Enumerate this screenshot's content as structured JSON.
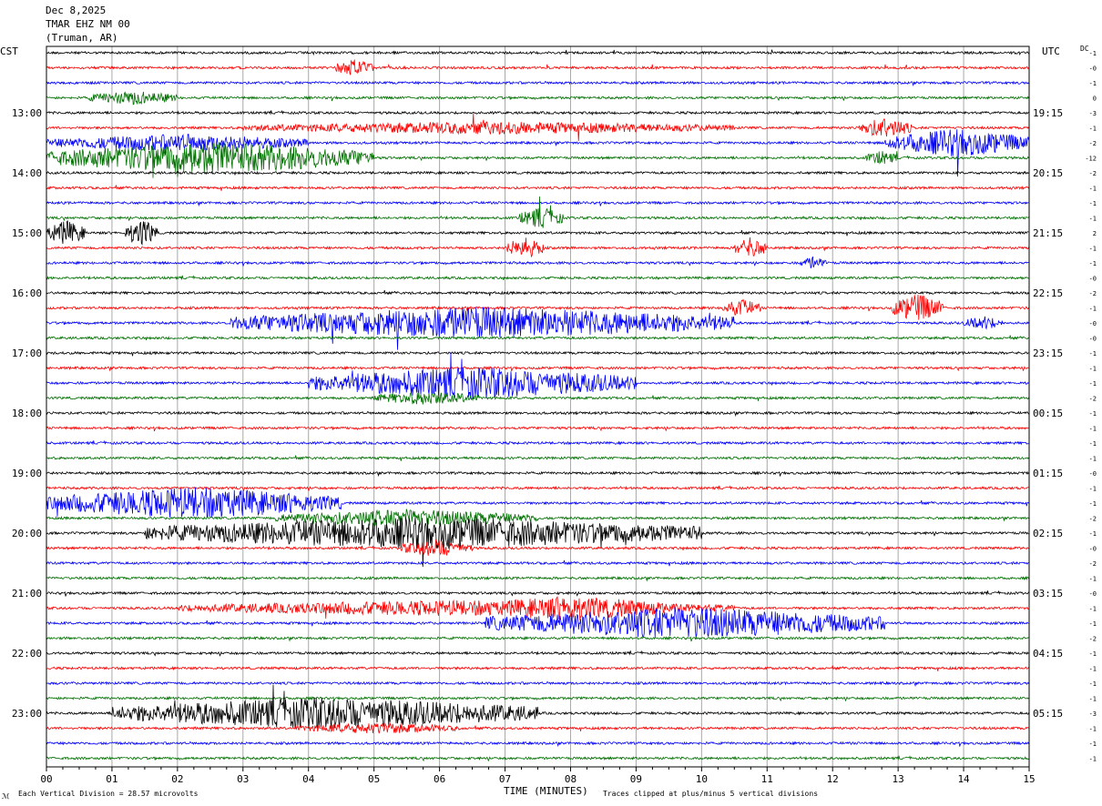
{
  "header": {
    "date": "Dec 8,2025",
    "station": "TMAR EHZ NM 00",
    "location": "(Truman, AR)"
  },
  "left_axis_label": "CST",
  "right_axis_label": "UTC",
  "dc_label": "DC",
  "footer": {
    "scale_text": "Each Vertical Division =   28.57 microvolts",
    "x_axis_title": "TIME (MINUTES)",
    "clip_text": "Traces clipped at plus/minus 5 vertical divisions",
    "corner_mark": "ℳ"
  },
  "chart_data": {
    "type": "line",
    "title": "",
    "xlabel": "TIME (MINUTES)",
    "ylabel": "",
    "xlim": [
      0,
      15
    ],
    "x_ticks": [
      "00",
      "01",
      "02",
      "03",
      "04",
      "05",
      "06",
      "07",
      "08",
      "09",
      "10",
      "11",
      "12",
      "13",
      "14",
      "15"
    ],
    "line_count": 48,
    "line_colors": [
      "#000000",
      "#ff0000",
      "#0000ff",
      "#007000"
    ],
    "cst_labels": [
      {
        "line": 4,
        "label": "13:00"
      },
      {
        "line": 8,
        "label": "14:00"
      },
      {
        "line": 12,
        "label": "15:00"
      },
      {
        "line": 16,
        "label": "16:00"
      },
      {
        "line": 20,
        "label": "17:00"
      },
      {
        "line": 24,
        "label": "18:00"
      },
      {
        "line": 28,
        "label": "19:00"
      },
      {
        "line": 32,
        "label": "20:00"
      },
      {
        "line": 36,
        "label": "21:00"
      },
      {
        "line": 40,
        "label": "22:00"
      },
      {
        "line": 44,
        "label": "23:00"
      }
    ],
    "utc_labels": [
      {
        "line": 4,
        "label": "19:15"
      },
      {
        "line": 8,
        "label": "20:15"
      },
      {
        "line": 12,
        "label": "21:15"
      },
      {
        "line": 16,
        "label": "22:15"
      },
      {
        "line": 20,
        "label": "23:15"
      },
      {
        "line": 24,
        "label": "00:15"
      },
      {
        "line": 28,
        "label": "01:15"
      },
      {
        "line": 32,
        "label": "02:15"
      },
      {
        "line": 36,
        "label": "03:15"
      },
      {
        "line": 40,
        "label": "04:15"
      },
      {
        "line": 44,
        "label": "05:15"
      }
    ],
    "dc_offsets": [
      "-1",
      "-0",
      "-1",
      "0",
      "-3",
      "-1",
      "-2",
      "-12",
      "-2",
      "-1",
      "-1",
      "-1",
      "2",
      "-1",
      "-1",
      "-0",
      "-2",
      "-1",
      "-0",
      "-0",
      "-1",
      "-1",
      "-1",
      "-2",
      "-1",
      "-1",
      "-1",
      "-1",
      "-0",
      "-1",
      "-1",
      "-2",
      "-1",
      "-0",
      "-2",
      "-1",
      "-0",
      "-1",
      "-1",
      "-2",
      "-1",
      "-1",
      "-1",
      "-1",
      "-3",
      "-1",
      "-1",
      "-1"
    ],
    "events": [
      {
        "line": 1,
        "start_min": 4.4,
        "end_min": 5.0,
        "amp": 2.5
      },
      {
        "line": 3,
        "start_min": 0.6,
        "end_min": 2.0,
        "amp": 2.0
      },
      {
        "line": 5,
        "start_min": 3.0,
        "end_min": 10.5,
        "amp": 1.8
      },
      {
        "line": 5,
        "start_min": 12.4,
        "end_min": 13.2,
        "amp": 3.0
      },
      {
        "line": 6,
        "start_min": 0.0,
        "end_min": 4.0,
        "amp": 2.5
      },
      {
        "line": 6,
        "start_min": 12.8,
        "end_min": 15.0,
        "amp": 4.0
      },
      {
        "line": 7,
        "start_min": 0.0,
        "end_min": 5.0,
        "amp": 4.5
      },
      {
        "line": 7,
        "start_min": 12.5,
        "end_min": 13.0,
        "amp": 2.0
      },
      {
        "line": 12,
        "start_min": 0.0,
        "end_min": 0.6,
        "amp": 3.5
      },
      {
        "line": 12,
        "start_min": 1.2,
        "end_min": 1.7,
        "amp": 4.0
      },
      {
        "line": 11,
        "start_min": 7.2,
        "end_min": 7.9,
        "amp": 3.0
      },
      {
        "line": 13,
        "start_min": 7.0,
        "end_min": 7.6,
        "amp": 3.0
      },
      {
        "line": 13,
        "start_min": 10.5,
        "end_min": 11.0,
        "amp": 3.0
      },
      {
        "line": 14,
        "start_min": 11.5,
        "end_min": 11.9,
        "amp": 1.8
      },
      {
        "line": 17,
        "start_min": 12.9,
        "end_min": 13.7,
        "amp": 4.0
      },
      {
        "line": 17,
        "start_min": 10.3,
        "end_min": 10.9,
        "amp": 2.5
      },
      {
        "line": 18,
        "start_min": 2.8,
        "end_min": 10.5,
        "amp": 4.5
      },
      {
        "line": 18,
        "start_min": 14.0,
        "end_min": 14.6,
        "amp": 2.0
      },
      {
        "line": 22,
        "start_min": 4.0,
        "end_min": 9.0,
        "amp": 4.5
      },
      {
        "line": 23,
        "start_min": 5.0,
        "end_min": 6.6,
        "amp": 2.0
      },
      {
        "line": 30,
        "start_min": 0.0,
        "end_min": 4.5,
        "amp": 4.5
      },
      {
        "line": 31,
        "start_min": 3.5,
        "end_min": 7.5,
        "amp": 2.5
      },
      {
        "line": 32,
        "start_min": 1.5,
        "end_min": 10.0,
        "amp": 4.5
      },
      {
        "line": 33,
        "start_min": 5.4,
        "end_min": 6.5,
        "amp": 2.5
      },
      {
        "line": 37,
        "start_min": 2.0,
        "end_min": 10.5,
        "amp": 2.2
      },
      {
        "line": 37,
        "start_min": 6.5,
        "end_min": 9.5,
        "amp": 3.5
      },
      {
        "line": 38,
        "start_min": 6.7,
        "end_min": 12.8,
        "amp": 4.5
      },
      {
        "line": 44,
        "start_min": 1.0,
        "end_min": 7.5,
        "amp": 4.5
      },
      {
        "line": 45,
        "start_min": 3.8,
        "end_min": 6.3,
        "amp": 1.6
      }
    ]
  }
}
